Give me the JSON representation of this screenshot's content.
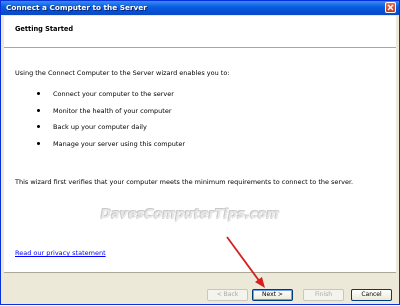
{
  "window": {
    "title": "Connect a Computer to the Server"
  },
  "header": {
    "title": "Getting Started"
  },
  "content": {
    "intro": "Using the Connect Computer to the Server wizard enables you to:",
    "bullets": [
      "Connect your computer to the server",
      "Monitor the health of your computer",
      "Back up your computer daily",
      "Manage your server using this computer"
    ],
    "verify_text": "This wizard first verifies that your computer meets the minimum requirements to connect to the server.",
    "watermark": "DavesComputerTips.com",
    "privacy_link": "Read our privacy statement"
  },
  "buttons": {
    "back": "< Back",
    "next": "Next >",
    "finish": "Finish",
    "cancel": "Cancel"
  },
  "colors": {
    "titlebar": "#0a5fe0",
    "arrow": "#d42020",
    "link": "#0000ff"
  }
}
